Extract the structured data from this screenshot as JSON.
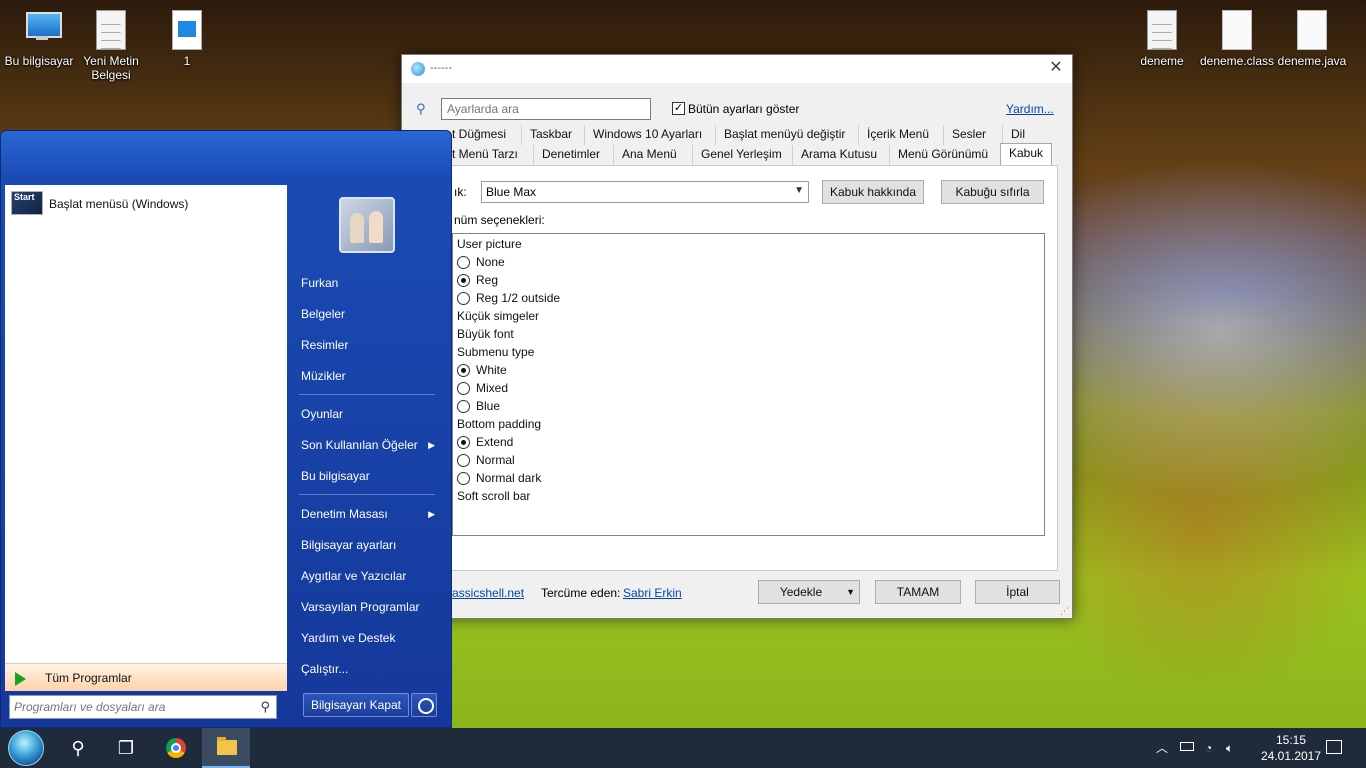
{
  "desktop": {
    "icons_left": [
      "Bu bilgisayar",
      "Yeni Metin Belgesi",
      "1"
    ],
    "icons_right": [
      "deneme",
      "deneme.class",
      "deneme.java"
    ]
  },
  "window": {
    "title": "------",
    "search_placeholder": "Ayarlarda ara",
    "show_all_label": "Bütün ayarları göster",
    "help_link": "Yardım...",
    "tabs_row1": [
      "t Düğmesi",
      "Taskbar",
      "Windows 10 Ayarları",
      "Başlat menüyü değiştir",
      "İçerik Menü",
      "Sesler",
      "Dil"
    ],
    "tabs_row2": [
      "t Menü Tarzı",
      "Denetimler",
      "Ana Menü",
      "Genel Yerleşim",
      "Arama Kutusu",
      "Menü Görünümü",
      "Kabuk"
    ],
    "skin_label": "ık:",
    "skin_value": "Blue Max",
    "about_skin_button": "Kabuk hakkında",
    "reset_skin_button": "Kabuğu sıfırla",
    "options_label": "nüm seçenekleri:",
    "options": [
      {
        "type": "header",
        "label": "User picture"
      },
      {
        "type": "radio",
        "label": "None",
        "checked": false
      },
      {
        "type": "radio",
        "label": "Reg",
        "checked": true
      },
      {
        "type": "radio",
        "label": "Reg 1/2 outside",
        "checked": false
      },
      {
        "type": "header",
        "label": "Küçük simgeler"
      },
      {
        "type": "header",
        "label": "Büyük font"
      },
      {
        "type": "header",
        "label": "Submenu type"
      },
      {
        "type": "radio",
        "label": "White",
        "checked": true
      },
      {
        "type": "radio",
        "label": "Mixed",
        "checked": false
      },
      {
        "type": "radio",
        "label": "Blue",
        "checked": false
      },
      {
        "type": "header",
        "label": "Bottom padding"
      },
      {
        "type": "radio",
        "label": "Extend",
        "checked": true
      },
      {
        "type": "radio",
        "label": "Normal",
        "checked": false
      },
      {
        "type": "radio",
        "label": "Normal dark",
        "checked": false
      },
      {
        "type": "header",
        "label": "Soft scroll bar"
      }
    ],
    "footer_link": "assicshell.net",
    "translated_by_label": "Tercüme eden:",
    "translator_link": "Sabri Erkin",
    "backup_button": "Yedekle",
    "ok_button": "TAMAM",
    "cancel_button": "İptal"
  },
  "start_menu": {
    "pinned_item": "Başlat menüsü (Windows)",
    "pinned_icon_text": "Start",
    "all_programs": "Tüm Programlar",
    "search_placeholder": "Programları ve dosyaları ara",
    "right_items_group1": [
      "Furkan",
      "Belgeler",
      "Resimler",
      "Müzikler"
    ],
    "right_items_group2": [
      "Oyunlar",
      "Son Kullanılan Öğeler",
      "Bu bilgisayar"
    ],
    "right_items_group3": [
      "Denetim Masası",
      "Bilgisayar ayarları",
      "Aygıtlar ve Yazıcılar",
      "Varsayılan Programlar",
      "Yardım ve Destek",
      "Çalıştır..."
    ],
    "shutdown_button": "Bilgisayarı Kapat"
  },
  "taskbar": {
    "time": "15:15",
    "date": "24.01.2017"
  }
}
